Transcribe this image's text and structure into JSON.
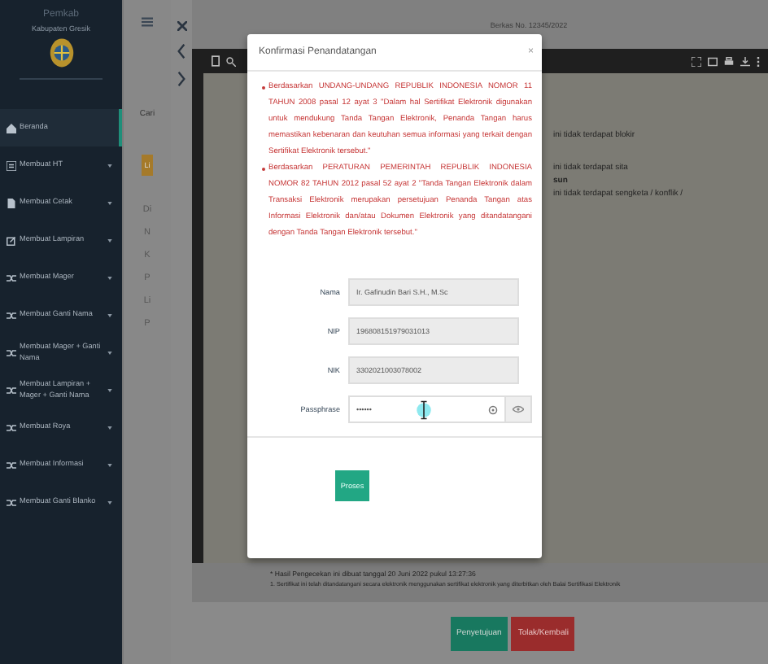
{
  "sidebar": {
    "brand": "Pemkab",
    "subtitle": "Kabupaten Gresik",
    "items": [
      {
        "label": "Beranda",
        "kind": "home",
        "selected": true,
        "has_caret": false
      },
      {
        "label": "Membuat HT",
        "kind": "list",
        "selected": false,
        "has_caret": true
      },
      {
        "label": "Membuat Cetak",
        "kind": "file",
        "selected": false,
        "has_caret": true
      },
      {
        "label": "Membuat Lampiran",
        "kind": "edit",
        "selected": false,
        "has_caret": true
      },
      {
        "label": "Membuat Mager",
        "kind": "shuffle",
        "selected": false,
        "has_caret": true
      },
      {
        "label": "Membuat Ganti Nama",
        "kind": "shuffle",
        "selected": false,
        "has_caret": true
      },
      {
        "label": "Membuat Mager + Ganti Nama",
        "kind": "shuffle",
        "selected": false,
        "has_caret": true
      },
      {
        "label": "Membuat Lampiran + Mager + Ganti Nama",
        "kind": "shuffle",
        "selected": false,
        "has_caret": true
      },
      {
        "label": "Membuat Roya",
        "kind": "shuffle",
        "selected": false,
        "has_caret": true
      },
      {
        "label": "Membuat Informasi",
        "kind": "shuffle",
        "selected": false,
        "has_caret": true
      },
      {
        "label": "Membuat Ganti Blanko",
        "kind": "shuffle",
        "selected": false,
        "has_caret": true
      }
    ]
  },
  "side_panel": {
    "search_label": "Cari",
    "badge": "Li",
    "letters": [
      "Di",
      "N",
      "K",
      "P",
      "Li",
      "P"
    ]
  },
  "viewer": {
    "header": "Berkas No. 12345/2022",
    "lines": [
      {
        "text": "ini tidak terdapat blokir",
        "kind": "plain"
      },
      {
        "text": "ini tidak terdapat sita",
        "kind": "plain"
      },
      {
        "text": "sun",
        "kind": "bold"
      },
      {
        "text": "ini tidak terdapat sengketa / konflik /",
        "kind": "plain"
      }
    ],
    "footnote": "* Hasil Pengecekan ini dibuat tanggal 20 Juni 2022 pukul 13:27:36",
    "footnote_small": "1. Sertifikat ini telah ditandatangani secara elektronik menggunakan sertifikat elektronik yang diterbitkan oleh Balai Sertifikasi Elektronik"
  },
  "modal": {
    "title": "Konfirmasi Penandatangan",
    "close": "×",
    "notes": [
      "Berdasarkan UNDANG-UNDANG REPUBLIK INDONESIA NOMOR 11 TAHUN 2008 pasal 12 ayat 3 \"Dalam hal Sertifikat Elektronik digunakan untuk mendukung Tanda Tangan Elektronik, Penanda Tangan harus memastikan kebenaran dan keutuhan semua informasi yang terkait dengan Sertifikat Elektronik tersebut.\"",
      "Berdasarkan PERATURAN PEMERINTAH REPUBLIK INDONESIA NOMOR 82 TAHUN 2012 pasal 52 ayat 2 \"Tanda Tangan Elektronik dalam Transaksi Elektronik merupakan persetujuan Penanda Tangan atas Informasi Elektronik dan/atau Dokumen Elektronik yang ditandatangani dengan Tanda Tangan Elektronik tersebut.\""
    ],
    "fields": [
      {
        "label": "Nama",
        "value": "Ir. Gafinudin Bari S.H., M.Sc",
        "disabled": true
      },
      {
        "label": "NIP",
        "value": "196808151979031013",
        "disabled": true
      },
      {
        "label": "NIK",
        "value": "3302021003078002",
        "disabled": true
      },
      {
        "label": "Passphrase",
        "value": "••••••",
        "disabled": false
      }
    ],
    "submit": "Proses"
  },
  "actions": [
    {
      "label": "Penyetujuan",
      "kind": "approve"
    },
    {
      "label": "Tolak/Kembali",
      "kind": "reject"
    }
  ]
}
